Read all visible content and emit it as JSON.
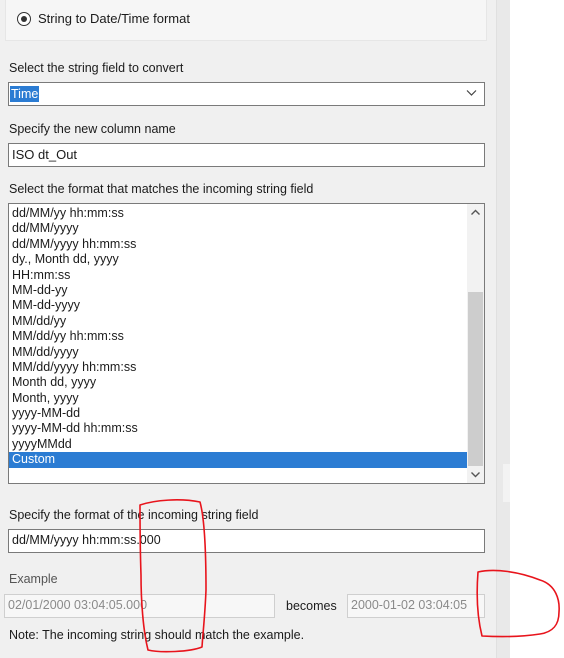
{
  "conversion_mode": {
    "radio_label": "String to Date/Time format",
    "selected": true
  },
  "string_field": {
    "label": "Select the string field to convert",
    "value": "Time"
  },
  "new_column": {
    "label": "Specify the new column name",
    "value": "ISO dt_Out"
  },
  "format_list": {
    "label": "Select the format that matches the incoming string field",
    "items": [
      "dd/MM/yy hh:mm:ss",
      "dd/MM/yyyy",
      "dd/MM/yyyy hh:mm:ss",
      "dy., Month dd, yyyy",
      "HH:mm:ss",
      "MM-dd-yy",
      "MM-dd-yyyy",
      "MM/dd/yy",
      "MM/dd/yy hh:mm:ss",
      "MM/dd/yyyy",
      "MM/dd/yyyy hh:mm:ss",
      "Month dd, yyyy",
      "Month, yyyy",
      "yyyy-MM-dd",
      "yyyy-MM-dd hh:mm:ss",
      "yyyyMMdd",
      "Custom"
    ],
    "selected_index": 16
  },
  "custom_format": {
    "label": "Specify the format of the incoming string field",
    "value": "dd/MM/yyyy hh:mm:ss.000"
  },
  "example": {
    "label": "Example",
    "input_value": "02/01/2000 03:04:05.000",
    "becomes_label": "becomes",
    "result_value": "2000-01-02 03:04:05"
  },
  "note": "Note: The incoming string should match the example.",
  "colors": {
    "selection": "#2b7cd3",
    "panel": "#f0f0f0",
    "annotation": "#e8141c"
  }
}
